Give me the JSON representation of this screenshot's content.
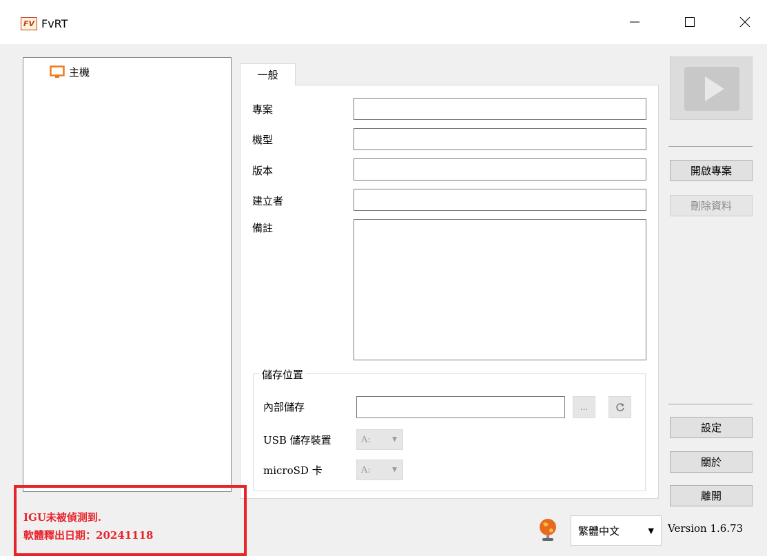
{
  "window": {
    "title": "FvRT",
    "app_icon_text": "FV"
  },
  "tree": {
    "root_label": "主機"
  },
  "tabs": [
    {
      "label": "一般"
    }
  ],
  "form": {
    "project_label": "專案",
    "project_value": "",
    "model_label": "機型",
    "model_value": "",
    "version_label": "版本",
    "version_value": "",
    "creator_label": "建立者",
    "creator_value": "",
    "notes_label": "備註",
    "notes_value": ""
  },
  "storage": {
    "group_title": "儲存位置",
    "internal_label": "內部儲存",
    "internal_value": "",
    "browse_label": "...",
    "usb_label": "USB 儲存裝置",
    "usb_value": "A:",
    "microsd_label": "microSD 卡",
    "microsd_value": "A:"
  },
  "actions": {
    "open_project": "開啟專案",
    "delete_data": "刪除資料",
    "settings": "設定",
    "about": "關於",
    "exit": "離開"
  },
  "status": {
    "line1": "IGU未被偵測到.",
    "line2": "軟體釋出日期：20241118"
  },
  "language": {
    "selected": "繁體中文"
  },
  "version_text": "Version 1.6.73",
  "colors": {
    "accent_red": "#e8242b",
    "monitor_orange": "#f07a1c"
  }
}
